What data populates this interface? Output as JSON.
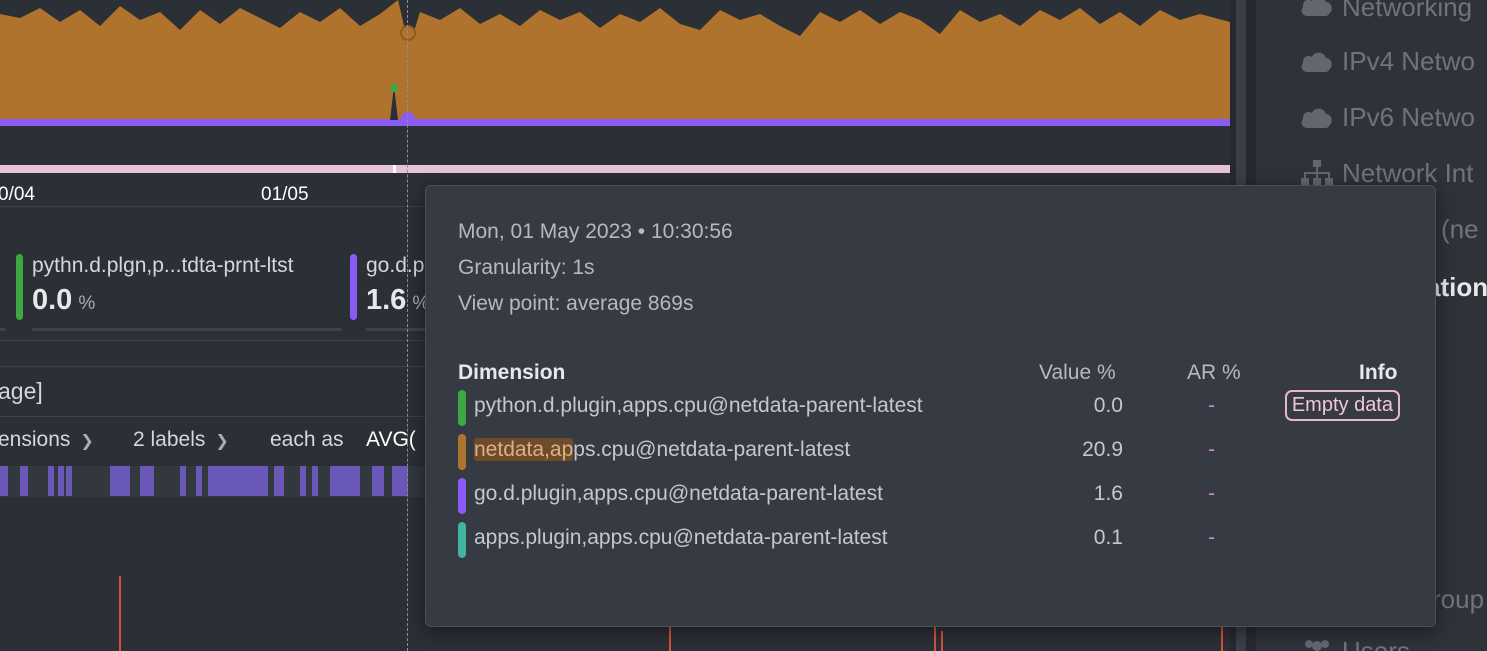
{
  "chart": {
    "x_labels": [
      "0/04",
      "01/05"
    ],
    "colors": {
      "orange": "#b0732d",
      "purple": "#8a5cf5",
      "green": "#3ea744",
      "teal": "#3fb59f",
      "pink": "#f0c8da"
    }
  },
  "legend": [
    {
      "name": "t",
      "value": "",
      "unit": "",
      "color": ""
    },
    {
      "name": "pythn.d.plgn,p...tdta-prnt-ltst",
      "value": "0.0",
      "unit": "%",
      "color": "#3ea744"
    },
    {
      "name": "go.d.p",
      "value": "1.6",
      "unit": "%",
      "color": "#8a5cf5"
    }
  ],
  "range_text": "age]",
  "controls": {
    "dimensions_label": "ensions",
    "labels_label": "2 labels",
    "aggregation_label": "each as",
    "aggregation_value": "AVG("
  },
  "sidebar": {
    "items": [
      {
        "label": "Networking",
        "icon": "cloud-icon"
      },
      {
        "label": "IPv4 Netwo",
        "icon": "cloud-icon"
      },
      {
        "label": "IPv6 Netwo",
        "icon": "cloud-icon"
      },
      {
        "label": "Network Int",
        "icon": "network-tree-icon"
      },
      {
        "label": "l (ne",
        "icon": ""
      }
    ],
    "bold_label": "ation",
    "lower_items": [
      {
        "label": "roup",
        "icon": ""
      },
      {
        "label": "Users",
        "icon": "users-icon"
      }
    ]
  },
  "tooltip": {
    "datetime": "Mon, 01 May 2023 • 10:30:56",
    "granularity": "Granularity: 1s",
    "view_point": "View point: average 869s",
    "headers": {
      "dimension": "Dimension",
      "value": "Value %",
      "ar": "AR %",
      "info": "Info"
    },
    "rows": [
      {
        "name": "python.d.plugin,apps.cpu@netdata-parent-latest",
        "value": "0.0",
        "ar": "-",
        "info": "Empty data",
        "color": "#3ea744"
      },
      {
        "name_highlight": "netdata,ap",
        "name_rest": "ps.cpu@netdata-parent-latest",
        "value": "20.9",
        "ar": "-",
        "info": "",
        "color": "#b0732d"
      },
      {
        "name": "go.d.plugin,apps.cpu@netdata-parent-latest",
        "value": "1.6",
        "ar": "-",
        "info": "",
        "color": "#8a5cf5"
      },
      {
        "name": "apps.plugin,apps.cpu@netdata-parent-latest",
        "value": "0.1",
        "ar": "-",
        "info": "",
        "color": "#3fb59f"
      }
    ]
  }
}
